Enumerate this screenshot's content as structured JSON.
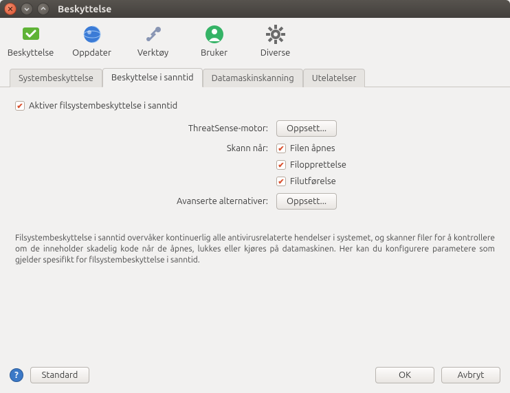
{
  "window": {
    "title": "Beskyttelse"
  },
  "toolbar": {
    "items": [
      {
        "label": "Beskyttelse"
      },
      {
        "label": "Oppdater"
      },
      {
        "label": "Verktøy"
      },
      {
        "label": "Bruker"
      },
      {
        "label": "Diverse"
      }
    ]
  },
  "tabs": [
    {
      "label": "Systembeskyttelse"
    },
    {
      "label": "Beskyttelse i sanntid"
    },
    {
      "label": "Datamaskinskanning"
    },
    {
      "label": "Utelatelser"
    }
  ],
  "panel": {
    "enable_label": "Aktiver filsystembeskyttelse i sanntid",
    "threatsense_label": "ThreatSense-motor:",
    "threatsense_button": "Oppsett...",
    "scan_when_label": "Skann når:",
    "scan_options": [
      {
        "label": "Filen åpnes"
      },
      {
        "label": "Filopprettelse"
      },
      {
        "label": "Filutførelse"
      }
    ],
    "advanced_label": "Avanserte alternativer:",
    "advanced_button": "Oppsett...",
    "description": "Filsystembeskyttelse i sanntid overvåker kontinuerlig alle antivirusrelaterte hendelser i systemet, og skanner filer for å kontrollere om de inneholder skadelig kode når de åpnes, lukkes eller kjøres på datamaskinen. Her kan du konfigurere parametere som gjelder spesifikt for filsystembeskyttelse i sanntid."
  },
  "footer": {
    "default_button": "Standard",
    "ok_button": "OK",
    "cancel_button": "Avbryt"
  }
}
